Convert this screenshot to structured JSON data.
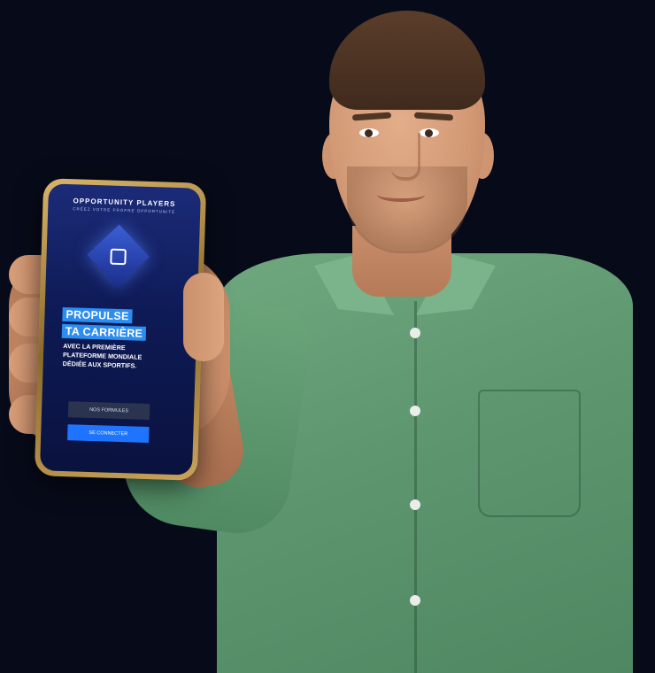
{
  "phone_app": {
    "brand": "OPPORTUNITY PLAYERS",
    "tagline": "CRÉEZ VOTRE PROPRE OPPORTUNITÉ",
    "headline_line1": "PROPULSE",
    "headline_line2": "TA CARRIÈRE",
    "subtitle_line1": "AVEC LA PREMIÈRE",
    "subtitle_line2": "PLATEFORME MONDIALE",
    "subtitle_line3": "DÉDIÉE AUX SPORTIFS.",
    "button_formules": "NOS FORMULES",
    "button_connect": "SE CONNECTER",
    "colors": {
      "screen_bg": "#0e1a55",
      "highlight": "#2b8df0",
      "connect_button": "#1f74ff",
      "formules_button": "#2b344f"
    }
  },
  "scene": {
    "background_color": "#070b19",
    "shirt_color": "#5e9670"
  }
}
